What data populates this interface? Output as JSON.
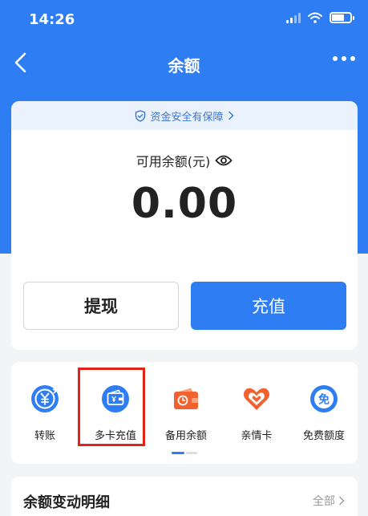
{
  "status_bar": {
    "time": "14:26"
  },
  "nav": {
    "title": "余额"
  },
  "balance": {
    "security_text": "资金安全有保障",
    "label": "可用余额(元)",
    "amount": "0.00"
  },
  "actions": {
    "withdraw_label": "提现",
    "recharge_label": "充值"
  },
  "quick_actions": [
    {
      "label": "转账",
      "icon": "yuan-transfer-icon"
    },
    {
      "label": "多卡充值",
      "icon": "wallet-card-icon"
    },
    {
      "label": "备用余额",
      "icon": "spare-wallet-icon"
    },
    {
      "label": "亲情卡",
      "icon": "heart-card-icon"
    },
    {
      "label": "免费额度",
      "icon": "free-quota-icon"
    }
  ],
  "details": {
    "title": "余额变动明细",
    "filter_label": "全部"
  },
  "colors": {
    "primary": "#2f7df3",
    "highlight": "#e2231a",
    "orange": "#f0622f"
  }
}
